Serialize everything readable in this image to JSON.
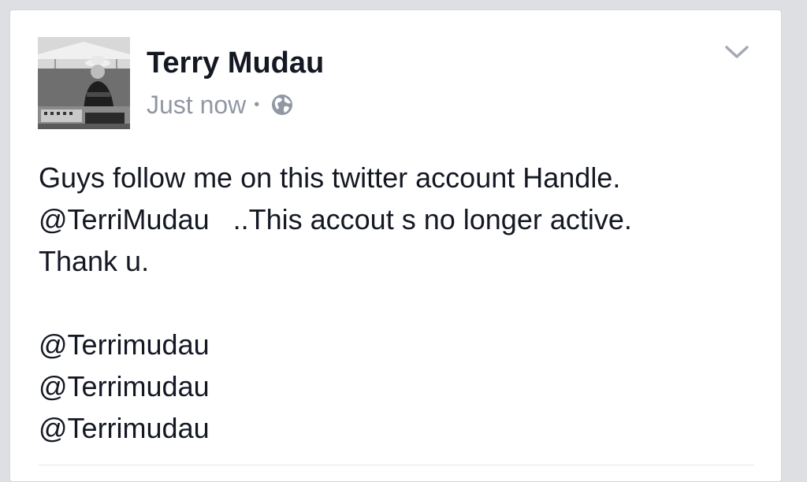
{
  "post": {
    "author_name": "Terry Mudau",
    "timestamp": "Just now",
    "separator": "•",
    "privacy_icon": "globe-icon",
    "menu_icon": "chevron-down-icon",
    "avatar_icon": "profile-photo",
    "lines": [
      "Guys follow me on this twitter account Handle.",
      "@TerriMudau   ..This accout s no longer active.",
      "Thank u."
    ],
    "handles": [
      "@Terrimudau",
      "@Terrimudau",
      "@Terrimudau"
    ]
  },
  "colors": {
    "page_background": "#dddfe2",
    "card_background": "#ffffff",
    "text_primary": "#141823",
    "text_secondary": "#9197a3"
  }
}
